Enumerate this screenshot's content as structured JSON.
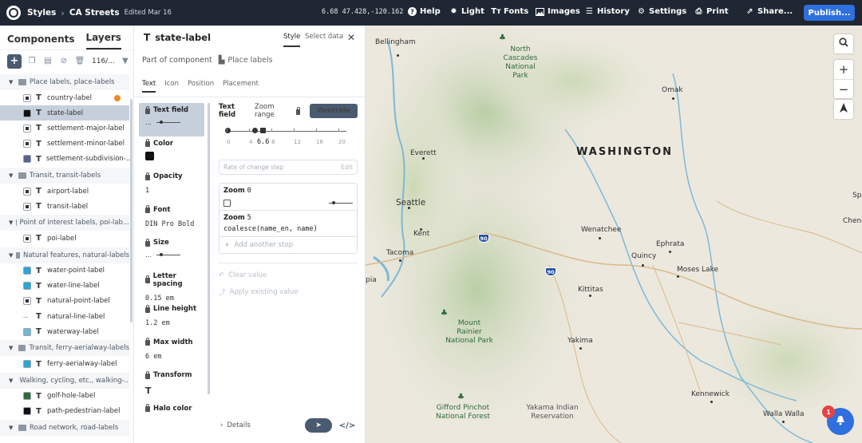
{
  "topbar": {
    "crumb1": "Styles",
    "crumb2": "CA Streets",
    "edited": "Edited Mar 16",
    "coords": "6.68 47.428,-120.162",
    "help": "Help",
    "light": "Light",
    "fonts": "Fonts",
    "images": "Images",
    "history": "History",
    "settings": "Settings",
    "print": "Print",
    "share": "Share...",
    "publish": "Publish..."
  },
  "left": {
    "tab_components": "Components",
    "tab_layers": "Layers",
    "count": "116/...",
    "groups": [
      {
        "label": "Place labels, place-labels",
        "layers": [
          {
            "label": "country-label",
            "swatch": "#ffffff",
            "selected": false,
            "warn": true
          },
          {
            "label": "state-label",
            "swatch": "#111111",
            "selected": true,
            "warn": false
          },
          {
            "label": "settlement-major-label",
            "swatch": "#ffffff",
            "selected": false,
            "warn": false
          },
          {
            "label": "settlement-minor-label",
            "swatch": "#ffffff",
            "selected": false,
            "warn": false
          },
          {
            "label": "settlement-subdivision-...",
            "swatch": "#5b5f8f",
            "selected": false,
            "warn": false
          }
        ]
      },
      {
        "label": "Transit, transit-labels",
        "layers": [
          {
            "label": "airport-label",
            "swatch": "#ffffff",
            "selected": false,
            "warn": false
          },
          {
            "label": "transit-label",
            "swatch": "#ffffff",
            "selected": false,
            "warn": false
          }
        ]
      },
      {
        "label": "Point of interest labels, poi-lab...",
        "layers": [
          {
            "label": "poi-label",
            "swatch": "#ffffff",
            "selected": false,
            "warn": false
          }
        ]
      },
      {
        "label": "Natural features, natural-labels",
        "layers": [
          {
            "label": "water-point-label",
            "swatch": "#2aa6d8",
            "selected": false,
            "warn": false
          },
          {
            "label": "water-line-label",
            "swatch": "#2aa6d8",
            "selected": false,
            "warn": false
          },
          {
            "label": "natural-point-label",
            "swatch": "#ffffff",
            "selected": false,
            "warn": false
          },
          {
            "label": "natural-line-label",
            "swatch": "none",
            "selected": false,
            "warn": false
          },
          {
            "label": "waterway-label",
            "swatch": "#6fb8d6",
            "selected": false,
            "warn": false
          }
        ]
      },
      {
        "label": "Transit, ferry-aerialway-labels",
        "layers": [
          {
            "label": "ferry-aerialway-label",
            "swatch": "#2aa6d8",
            "selected": false,
            "warn": false
          }
        ]
      },
      {
        "label": "Walking, cycling, etc., walking-...",
        "layers": [
          {
            "label": "golf-hole-label",
            "swatch": "#2f6a3b",
            "selected": false,
            "warn": false
          },
          {
            "label": "path-pedestrian-label",
            "swatch": "#111111",
            "selected": false,
            "warn": false
          }
        ]
      },
      {
        "label": "Road network, road-labels",
        "layers": []
      }
    ]
  },
  "mid": {
    "title": "state-label",
    "tab_style": "Style",
    "tab_select": "Select data",
    "part_of": "Part of component",
    "component": "Place labels",
    "subtabs": [
      "Text",
      "Icon",
      "Position",
      "Placement"
    ],
    "props": [
      {
        "label": "Text field",
        "value": "...",
        "kind": "slider"
      },
      {
        "label": "Color",
        "value": "",
        "kind": "chip"
      },
      {
        "label": "Opacity",
        "value": "1",
        "kind": "text"
      },
      {
        "label": "Font",
        "value": "DIN Pro Bold",
        "kind": "text"
      },
      {
        "label": "Size",
        "value": "...",
        "kind": "slider"
      },
      {
        "label": "Letter spacing",
        "value": "0.15 em",
        "kind": "text"
      },
      {
        "label": "Line height",
        "value": "1.2 em",
        "kind": "text"
      },
      {
        "label": "Max width",
        "value": "6 em",
        "kind": "text"
      },
      {
        "label": "Transform",
        "value": "T",
        "kind": "text"
      },
      {
        "label": "Halo color",
        "value": "",
        "kind": "none"
      }
    ],
    "editor": {
      "field": "Text field",
      "zoom_range": "Zoom range",
      "override": "Override",
      "zoom_value": "6.6",
      "ticks": [
        "0",
        "4",
        "8",
        "12",
        "16",
        "20"
      ],
      "rate": "Rate of change",
      "rate_step": "step",
      "rate_edit": "Edit",
      "stop0": "Zoom",
      "stop0_zoom": "0",
      "stop5": "Zoom",
      "stop5_zoom": "5",
      "stop5_expr": "coalesce(name_en, name)",
      "add_stop": "Add another stop",
      "clear": "Clear value",
      "apply": "Apply existing value",
      "details": "Details"
    }
  },
  "map": {
    "state_label": "WASHINGTON",
    "places": [
      {
        "name": "Bellingham"
      },
      {
        "name": "North Cascades National Park"
      },
      {
        "name": "Omak"
      },
      {
        "name": "Everett"
      },
      {
        "name": "Seattle"
      },
      {
        "name": "Kent"
      },
      {
        "name": "Tacoma"
      },
      {
        "name": "Wenatchee"
      },
      {
        "name": "Ephrata"
      },
      {
        "name": "Quincy"
      },
      {
        "name": "Moses Lake"
      },
      {
        "name": "Kittitas"
      },
      {
        "name": "Mount Rainier National Park"
      },
      {
        "name": "Yakima"
      },
      {
        "name": "Gifford Pinchot National Forest"
      },
      {
        "name": "Yakama Indian Reservation"
      },
      {
        "name": "Kennewick"
      },
      {
        "name": "Walla Walla"
      },
      {
        "name": "Spo"
      },
      {
        "name": "Chene"
      },
      {
        "name": "pia"
      }
    ],
    "shields": [
      "90",
      "90"
    ],
    "notifications": "1"
  }
}
